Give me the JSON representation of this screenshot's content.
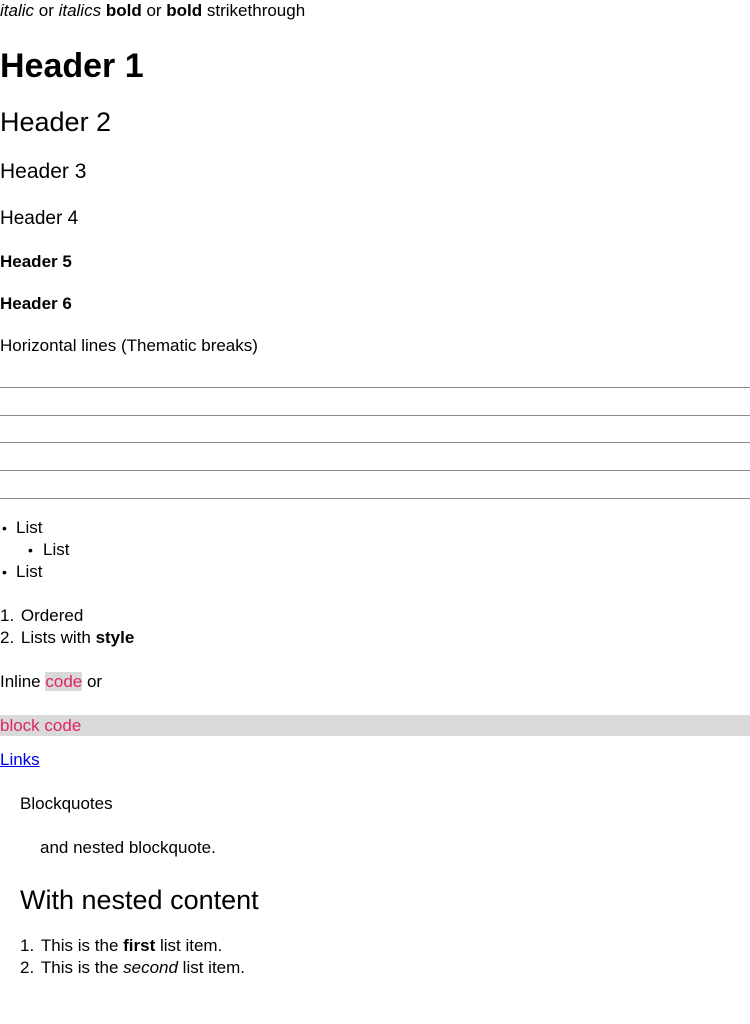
{
  "emphasis_line": {
    "italic1": "italic",
    "or1": " or ",
    "italic2": "italics",
    "space1": " ",
    "bold1": "bold",
    "or2": " or ",
    "bold2": "bold",
    "strike": " strikethrough"
  },
  "headers": {
    "h1": "Header 1",
    "h2": "Header 2",
    "h3": "Header 3",
    "h4": "Header 4",
    "h5": "Header 5",
    "h6": "Header 6"
  },
  "hr_caption": "Horizontal lines (Thematic breaks)",
  "unordered": [
    "List",
    "List",
    "List"
  ],
  "ordered": {
    "item1_num": "1.",
    "item1_text": "Ordered",
    "item2_num": "2.",
    "item2_text": "Lists with ",
    "item2_bold": "style"
  },
  "inline_code": {
    "prefix": "Inline ",
    "code": "code",
    "suffix": " or"
  },
  "block_code": "block code",
  "link_text": "Links",
  "blockquote": {
    "line1": "Blockquotes",
    "nested": "and nested blockquote.",
    "heading": "With nested content",
    "item1_num": "1.",
    "item1_pre": "This is the ",
    "item1_bold": "first",
    "item1_post": " list item.",
    "item2_num": "2.",
    "item2_pre": "This is the ",
    "item2_em": "second",
    "item2_post": " list item."
  },
  "colors": {
    "code_text": "#e0245e",
    "code_bg": "#d9d9d9",
    "link": "#0000ee",
    "rule": "#8a8a8a"
  }
}
